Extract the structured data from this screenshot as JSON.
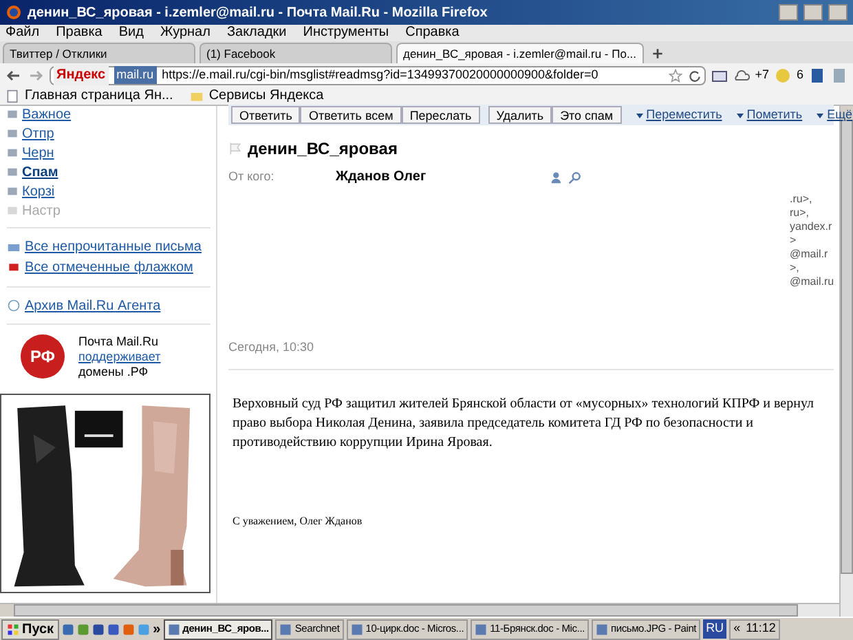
{
  "window": {
    "title": "денин_ВС_яровая - i.zemler@mail.ru - Почта Mail.Ru - Mozilla Firefox"
  },
  "menu": [
    "Файл",
    "Правка",
    "Вид",
    "Журнал",
    "Закладки",
    "Инструменты",
    "Справка"
  ],
  "tabs": [
    {
      "label": "Твиттер / Отклики",
      "selected": false
    },
    {
      "label": "(1) Facebook",
      "selected": false
    },
    {
      "label": "денин_ВС_яровая - i.zemler@mail.ru - По...",
      "selected": true
    }
  ],
  "nav": {
    "search_logo": "Яндекс",
    "site_badge": "mail.ru",
    "url": "https://e.mail.ru/cgi-bin/msglist#readmsg?id=13499370020000000900&folder=0",
    "cloud_count": "+7",
    "badge_count": "6"
  },
  "bookmarks": [
    "Главная страница Ян...",
    "Сервисы Яндекса"
  ],
  "sidebar": {
    "folders": [
      {
        "label": "Важное",
        "kind": "link"
      },
      {
        "label": "Отпр",
        "kind": "link"
      },
      {
        "label": "Черн",
        "kind": "link"
      },
      {
        "label": "Спам",
        "kind": "bold"
      },
      {
        "label": "Корзі",
        "kind": "link"
      },
      {
        "label": "Настр",
        "kind": "muted"
      }
    ],
    "filters": [
      "Все непрочитанные письма",
      "Все отмеченные флажком"
    ],
    "agent_archive": "Архив Mail.Ru Агента",
    "promo": {
      "logo": "РФ",
      "line_1": "Почта Mail.Ru",
      "link": "поддерживает",
      "line_2": "домены .РФ"
    }
  },
  "toolbar": {
    "groups": [
      [
        "Ответить",
        "Ответить всем",
        "Переслать"
      ],
      [
        "Удалить",
        "Это спам"
      ]
    ],
    "menus": [
      "Переместить",
      "Пометить",
      "Ещё"
    ]
  },
  "message": {
    "subject": "денин_ВС_яровая",
    "from_label": "От кого:",
    "from_name": "Жданов Олег",
    "recipients": [
      ".ru>,",
      "ru>,",
      "yandex.r",
      ">",
      "@mail.r",
      ">,",
      "@mail.ru"
    ],
    "date": "Сегодня, 10:30",
    "body": "Верховный суд РФ защитил жителей Брянской области от «мусорных» технологий КПРФ и вернул право выбора Николая Денина, заявила председатель комитета ГД РФ по безопасности и противодействию коррупции Ирина Яровая.",
    "signature": "С уважением, Олег Жданов"
  },
  "taskbar": {
    "start": "Пуск",
    "more": "»",
    "tasks": [
      {
        "label": "денин_ВС_яров...",
        "selected": true
      },
      {
        "label": "Searchnet",
        "selected": false
      },
      {
        "label": "10-цирк.doc - Micros...",
        "selected": false
      },
      {
        "label": "11-Брянск.doc - Mic...",
        "selected": false
      },
      {
        "label": "письмо.JPG - Paint",
        "selected": false
      }
    ],
    "language": "RU",
    "tray_toggle": "«",
    "clock": "11:12"
  }
}
